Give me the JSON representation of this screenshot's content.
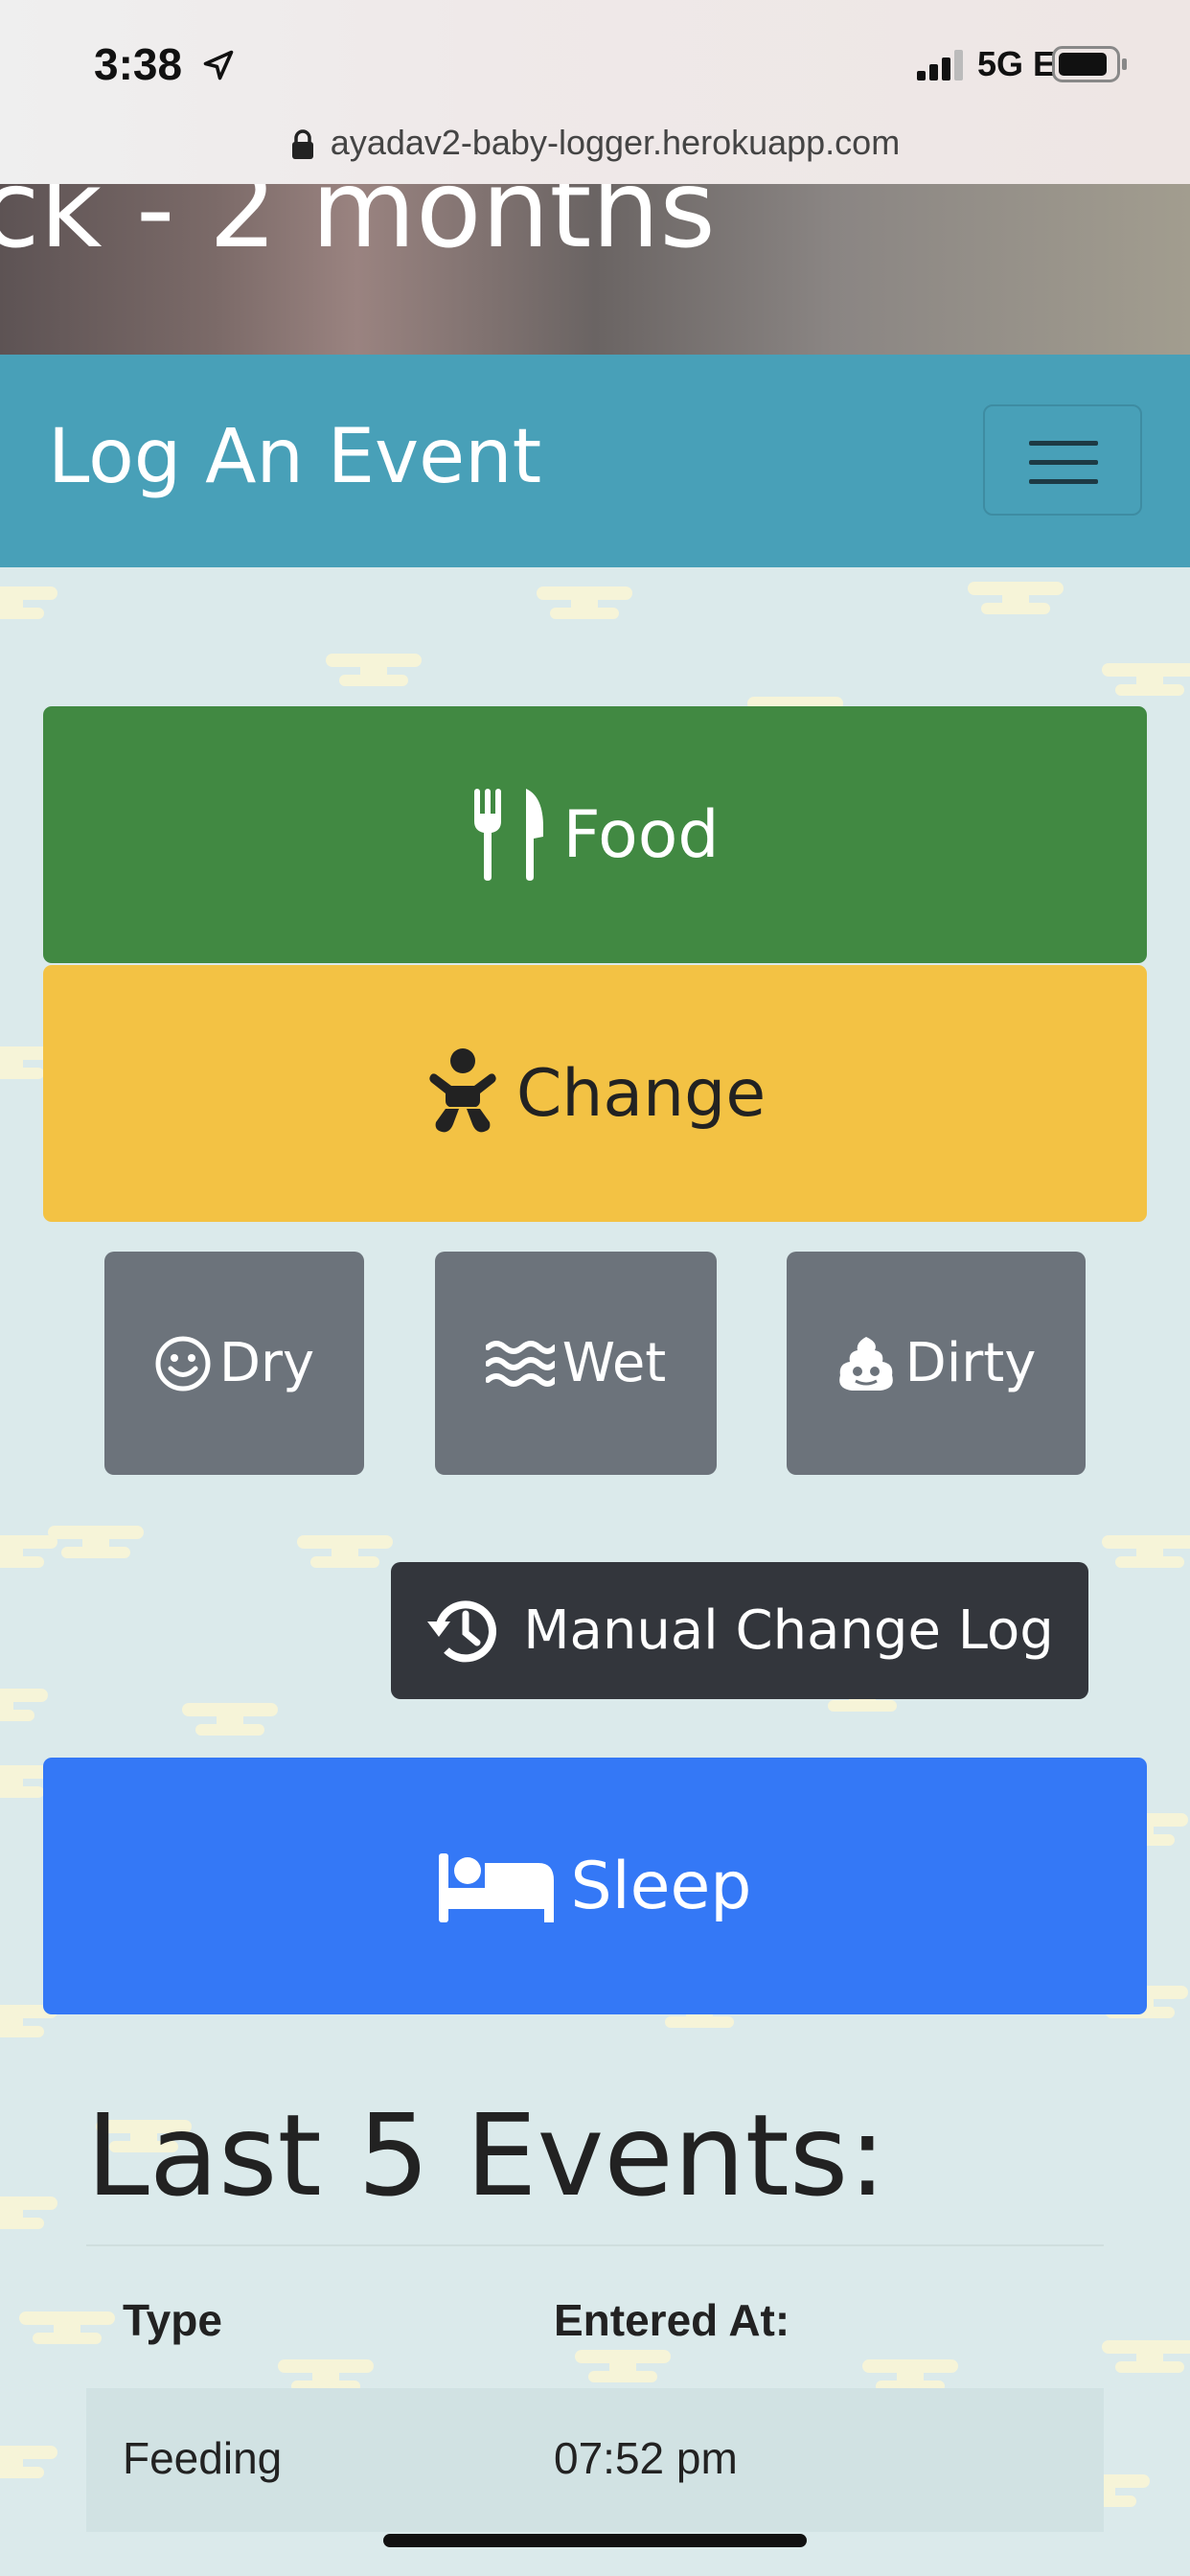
{
  "status_bar": {
    "time": "3:38",
    "network": "5G E"
  },
  "browser": {
    "url": "ayadav2-baby-logger.herokuapp.com"
  },
  "hero": {
    "title": "ck - 2 months"
  },
  "navbar": {
    "title": "Log An Event"
  },
  "buttons": {
    "food": "Food",
    "change": "Change",
    "dry": "Dry",
    "wet": "Wet",
    "dirty": "Dirty",
    "manual_change_log": "Manual Change Log",
    "sleep": "Sleep"
  },
  "icons": {
    "food": "utensils-icon",
    "change": "baby-icon",
    "dry": "smile-icon",
    "wet": "water-icon",
    "dirty": "poop-icon",
    "manual": "history-icon",
    "sleep": "bed-icon"
  },
  "colors": {
    "navbar": "#48a0b8",
    "food": "#418942",
    "change": "#f3c244",
    "secondary": "#6c737b",
    "dark": "#33363c",
    "sleep": "#3478f6"
  },
  "events": {
    "heading": "Last 5 Events:",
    "columns": [
      "Type",
      "Entered At:"
    ],
    "rows": [
      {
        "type": "Feeding",
        "entered_at": "07:52 pm"
      }
    ]
  }
}
